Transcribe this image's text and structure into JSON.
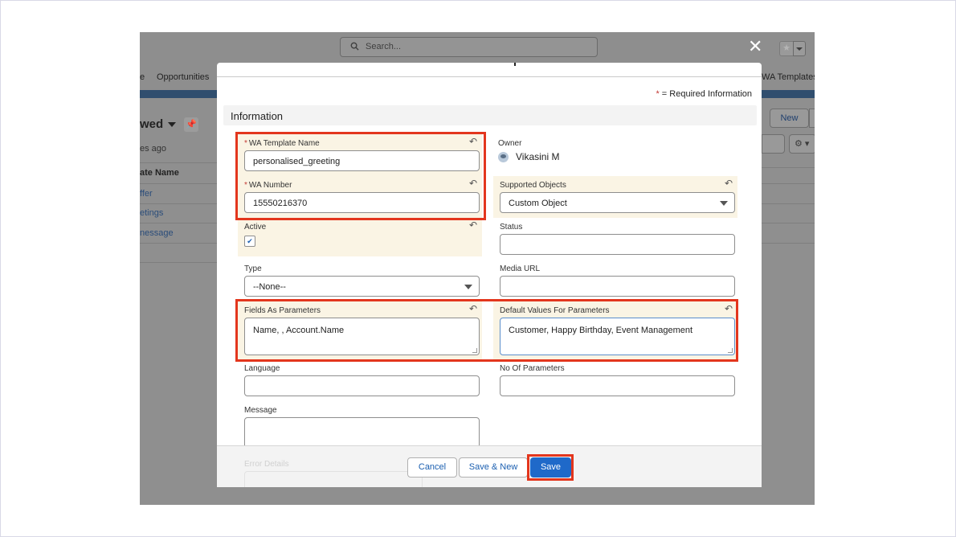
{
  "header": {
    "search_placeholder": "Search...",
    "close_glyph": "✕"
  },
  "background": {
    "nav": {
      "prev_tab_fragment": "e",
      "opportunities": "Opportunities",
      "wa_templates": "WA Templates"
    },
    "list_view_title": "wed",
    "list_view_subtitle": "es ago",
    "column_header": "ate Name",
    "rows": [
      "ffer",
      "etings",
      "nessage"
    ],
    "new_button": "New"
  },
  "modal": {
    "required_info": "= Required Information",
    "required_marker": "*",
    "section_title": "Information",
    "fields": {
      "wa_template_name": {
        "label": "WA Template Name",
        "value": "personalised_greeting",
        "required": true
      },
      "wa_number": {
        "label": "WA Number",
        "value": "15550216370",
        "required": true
      },
      "active": {
        "label": "Active",
        "checked": true
      },
      "owner": {
        "label": "Owner",
        "value": "Vikasini M"
      },
      "supported_objects": {
        "label": "Supported Objects",
        "value": "Custom Object"
      },
      "status": {
        "label": "Status",
        "value": ""
      },
      "type": {
        "label": "Type",
        "value": "--None--"
      },
      "media_url": {
        "label": "Media URL",
        "value": ""
      },
      "fields_as_parameters": {
        "label": "Fields As Parameters",
        "value": "Name, , Account.Name"
      },
      "default_values_for_parameters": {
        "label": "Default Values For Parameters",
        "value": "Customer, Happy Birthday, Event Management"
      },
      "language": {
        "label": "Language",
        "value": ""
      },
      "no_of_parameters": {
        "label": "No Of Parameters",
        "value": ""
      },
      "message": {
        "label": "Message",
        "value": ""
      },
      "error_details": {
        "label": "Error Details"
      }
    },
    "buttons": {
      "cancel": "Cancel",
      "save_new": "Save & New",
      "save": "Save"
    }
  },
  "colors": {
    "highlight": "#e3361d",
    "primary": "#1f69c9",
    "edited_field_bg": "#faf4e4"
  }
}
